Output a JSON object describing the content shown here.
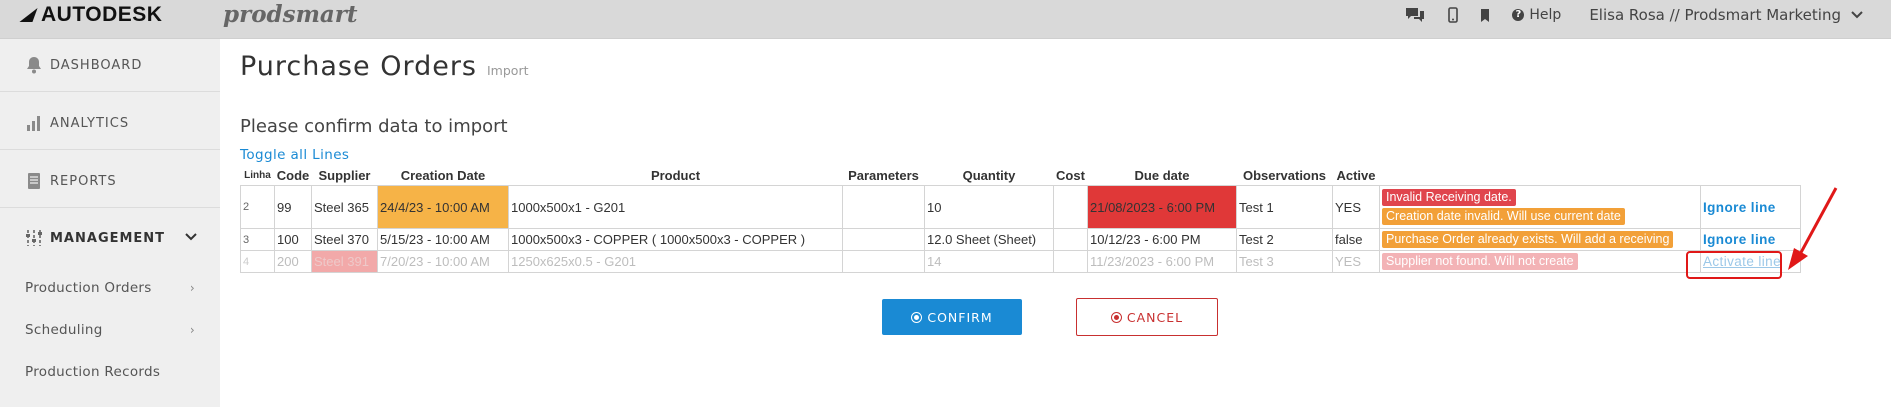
{
  "header": {
    "brand": "AUTODESK",
    "product": "prodsmart",
    "help_label": "Help",
    "user_label": "Elisa Rosa // Prodsmart Marketing"
  },
  "sidebar": {
    "items": [
      {
        "label": "DASHBOARD",
        "icon": "bell-icon"
      },
      {
        "label": "ANALYTICS",
        "icon": "bar-chart-icon"
      },
      {
        "label": "REPORTS",
        "icon": "document-icon"
      },
      {
        "label": "MANAGEMENT",
        "icon": "sliders-icon"
      }
    ],
    "sub_items": [
      {
        "label": "Production Orders",
        "has_arrow": true
      },
      {
        "label": "Scheduling",
        "has_arrow": true
      },
      {
        "label": "Production Records",
        "has_arrow": false
      }
    ]
  },
  "main": {
    "title": "Purchase Orders",
    "subtitle": "Import",
    "confirm_heading": "Please confirm data to import",
    "toggle_label": "Toggle all Lines",
    "columns": [
      "Linha",
      "Code",
      "Supplier",
      "Creation Date",
      "Product",
      "Parameters",
      "Quantity",
      "Cost",
      "Due date",
      "Observations",
      "Active"
    ],
    "rows": [
      {
        "linha": "2",
        "code": "99",
        "supplier": "Steel 365",
        "creation_date": "24/4/23 - 10:00 AM",
        "product": "1000x500x1 - G201",
        "parameters": "",
        "quantity": "10",
        "cost": "",
        "due_date": "21/08/2023 - 6:00 PM",
        "observations": "Test 1",
        "active": "YES",
        "messages": [
          "Invalid Receiving date.",
          "Creation date invalid. Will use current date"
        ],
        "action": "Ignore line"
      },
      {
        "linha": "3",
        "code": "100",
        "supplier": "Steel 370",
        "creation_date": "5/15/23 - 10:00 AM",
        "product": "1000x500x3 - COPPER ( 1000x500x3 - COPPER )",
        "parameters": "",
        "quantity": "12.0 Sheet (Sheet)",
        "cost": "",
        "due_date": "10/12/23 - 6:00 PM",
        "observations": "Test 2",
        "active": "false",
        "messages": [
          "Purchase Order already exists. Will add a receiving"
        ],
        "action": "Ignore line"
      },
      {
        "linha": "4",
        "code": "200",
        "supplier": "Steel 391",
        "creation_date": "7/20/23 - 10:00 AM",
        "product": "1250x625x0.5 - G201",
        "parameters": "",
        "quantity": "14",
        "cost": "",
        "due_date": "11/23/2023 - 6:00 PM",
        "observations": "Test 3",
        "active": "YES",
        "messages": [
          "Supplier not found. Will not create"
        ],
        "action": "Activate line"
      }
    ],
    "confirm_label": "CONFIRM",
    "cancel_label": "CANCEL"
  },
  "colors": {
    "accent": "#1a8ad4",
    "warning": "#f6b347",
    "error": "#e03838",
    "disabled_error": "#f2a9a9"
  }
}
